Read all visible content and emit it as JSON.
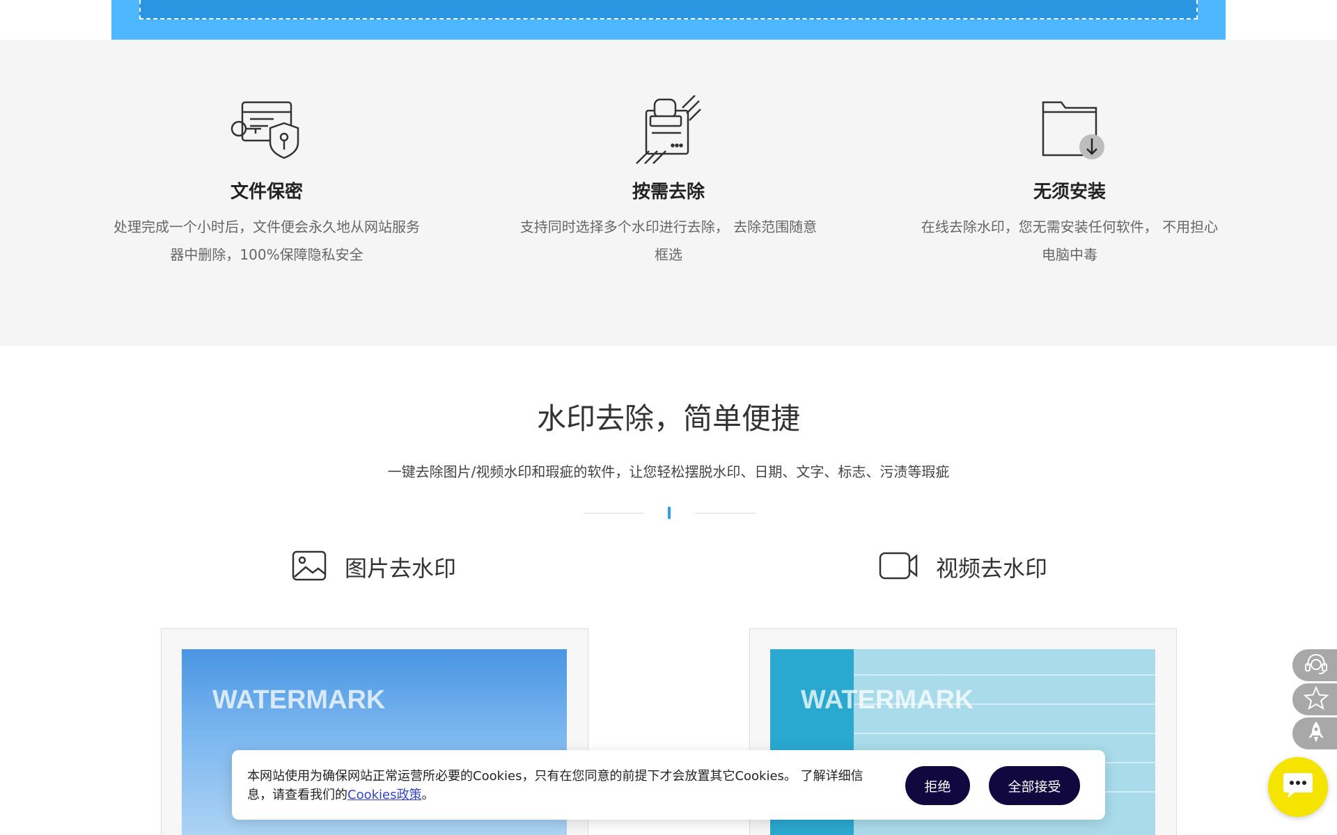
{
  "features": [
    {
      "icon": "lock-shield-icon",
      "title": "文件保密",
      "desc": "处理完成一个小时后，文件便会永久地从网站服务器中删除，100%保障隐私安全"
    },
    {
      "icon": "stamp-icon",
      "title": "按需去除",
      "desc": "支持同时选择多个水印进行去除， 去除范围随意框选"
    },
    {
      "icon": "folder-download-icon",
      "title": "无须安装",
      "desc": "在线去除水印，您无需安装任何软件， 不用担心电脑中毒"
    }
  ],
  "intro": {
    "title": "水印去除，简单便捷",
    "subtitle": "一键去除图片/视频水印和瑕疵的软件，让您轻松摆脱水印、日期、文字、标志、污渍等瑕疵"
  },
  "tabs": [
    {
      "icon": "image-icon",
      "label": "图片去水印"
    },
    {
      "icon": "video-icon",
      "label": "视频去水印"
    }
  ],
  "cards": [
    {
      "watermark": "WATERMARK"
    },
    {
      "watermark": "WATERMARK"
    }
  ],
  "cookie": {
    "text": "本网站使用为确保网站正常运营所必要的Cookies，只有在您同意的前提下才会放置其它Cookies。 了解详细信息，请查看我们的",
    "link": "Cookies政策",
    "suffix": "。",
    "reject": "拒绝",
    "accept": "全部接受"
  },
  "sidebar": [
    {
      "icon": "support-headset-icon"
    },
    {
      "icon": "star-icon"
    },
    {
      "icon": "rocket-icon"
    }
  ],
  "chat": {
    "icon": "chat-bubble-icon"
  },
  "colors": {
    "accent": "#2a9fea",
    "upload_bg": "#4db8ff",
    "cookie_button": "#10083f",
    "chat_button": "#f5e400"
  }
}
